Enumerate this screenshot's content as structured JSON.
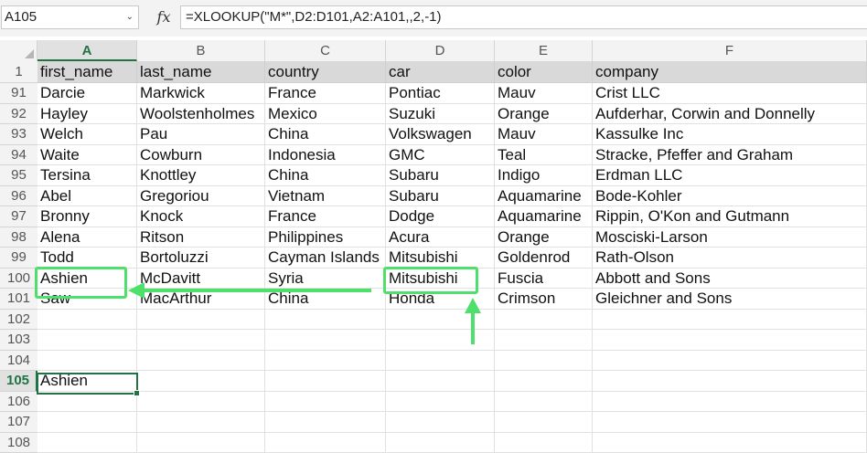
{
  "formula_bar": {
    "name_box": "A105",
    "fx_label": "fx",
    "formula": "=XLOOKUP(\"M*\",D2:D101,A2:A101,,2,-1)"
  },
  "columns": [
    "A",
    "B",
    "C",
    "D",
    "E",
    "F"
  ],
  "header_row": {
    "row_number": "1",
    "cells": [
      "first_name",
      "last_name",
      "country",
      "car",
      "color",
      "company"
    ]
  },
  "rows": [
    {
      "row_number": "91",
      "cells": [
        "Darcie",
        "Markwick",
        "France",
        "Pontiac",
        "Mauv",
        "Crist LLC"
      ]
    },
    {
      "row_number": "92",
      "cells": [
        "Hayley",
        "Woolstenholmes",
        "Mexico",
        "Suzuki",
        "Orange",
        "Aufderhar, Corwin and Donnelly"
      ]
    },
    {
      "row_number": "93",
      "cells": [
        "Welch",
        "Pau",
        "China",
        "Volkswagen",
        "Mauv",
        "Kassulke Inc"
      ]
    },
    {
      "row_number": "94",
      "cells": [
        "Waite",
        "Cowburn",
        "Indonesia",
        "GMC",
        "Teal",
        "Stracke, Pfeffer and Graham"
      ]
    },
    {
      "row_number": "95",
      "cells": [
        "Tersina",
        "Knottley",
        "China",
        "Subaru",
        "Indigo",
        "Erdman LLC"
      ]
    },
    {
      "row_number": "96",
      "cells": [
        "Abel",
        "Gregoriou",
        "Vietnam",
        "Subaru",
        "Aquamarine",
        "Bode-Kohler"
      ]
    },
    {
      "row_number": "97",
      "cells": [
        "Bronny",
        "Knock",
        "France",
        "Dodge",
        "Aquamarine",
        "Rippin, O'Kon and Gutmann"
      ]
    },
    {
      "row_number": "98",
      "cells": [
        "Alena",
        "Ritson",
        "Philippines",
        "Acura",
        "Orange",
        "Mosciski-Larson"
      ]
    },
    {
      "row_number": "99",
      "cells": [
        "Todd",
        "Bortoluzzi",
        "Cayman Islands",
        "Mitsubishi",
        "Goldenrod",
        "Rath-Olson"
      ]
    },
    {
      "row_number": "100",
      "cells": [
        "Ashien",
        "McDavitt",
        "Syria",
        "Mitsubishi",
        "Fuscia",
        "Abbott and Sons"
      ]
    },
    {
      "row_number": "101",
      "cells": [
        "Saw",
        "MacArthur",
        "China",
        "Honda",
        "Crimson",
        "Gleichner and Sons"
      ]
    },
    {
      "row_number": "102",
      "cells": [
        "",
        "",
        "",
        "",
        "",
        ""
      ]
    },
    {
      "row_number": "103",
      "cells": [
        "",
        "",
        "",
        "",
        "",
        ""
      ]
    },
    {
      "row_number": "104",
      "cells": [
        "",
        "",
        "",
        "",
        "",
        ""
      ]
    },
    {
      "row_number": "105",
      "cells": [
        "Ashien",
        "",
        "",
        "",
        "",
        ""
      ]
    },
    {
      "row_number": "106",
      "cells": [
        "",
        "",
        "",
        "",
        "",
        ""
      ]
    },
    {
      "row_number": "107",
      "cells": [
        "",
        "",
        "",
        "",
        "",
        ""
      ]
    },
    {
      "row_number": "108",
      "cells": [
        "",
        "",
        "",
        "",
        "",
        ""
      ]
    }
  ],
  "selection": {
    "active_cell": "A105",
    "active_column": "A",
    "active_row": "105"
  },
  "annotations": {
    "highlight_color": "#4ee06a",
    "highlighted_cells": [
      "A100",
      "D100"
    ]
  },
  "colors": {
    "excel_green": "#217346",
    "header_fill": "#d9d9d9"
  }
}
